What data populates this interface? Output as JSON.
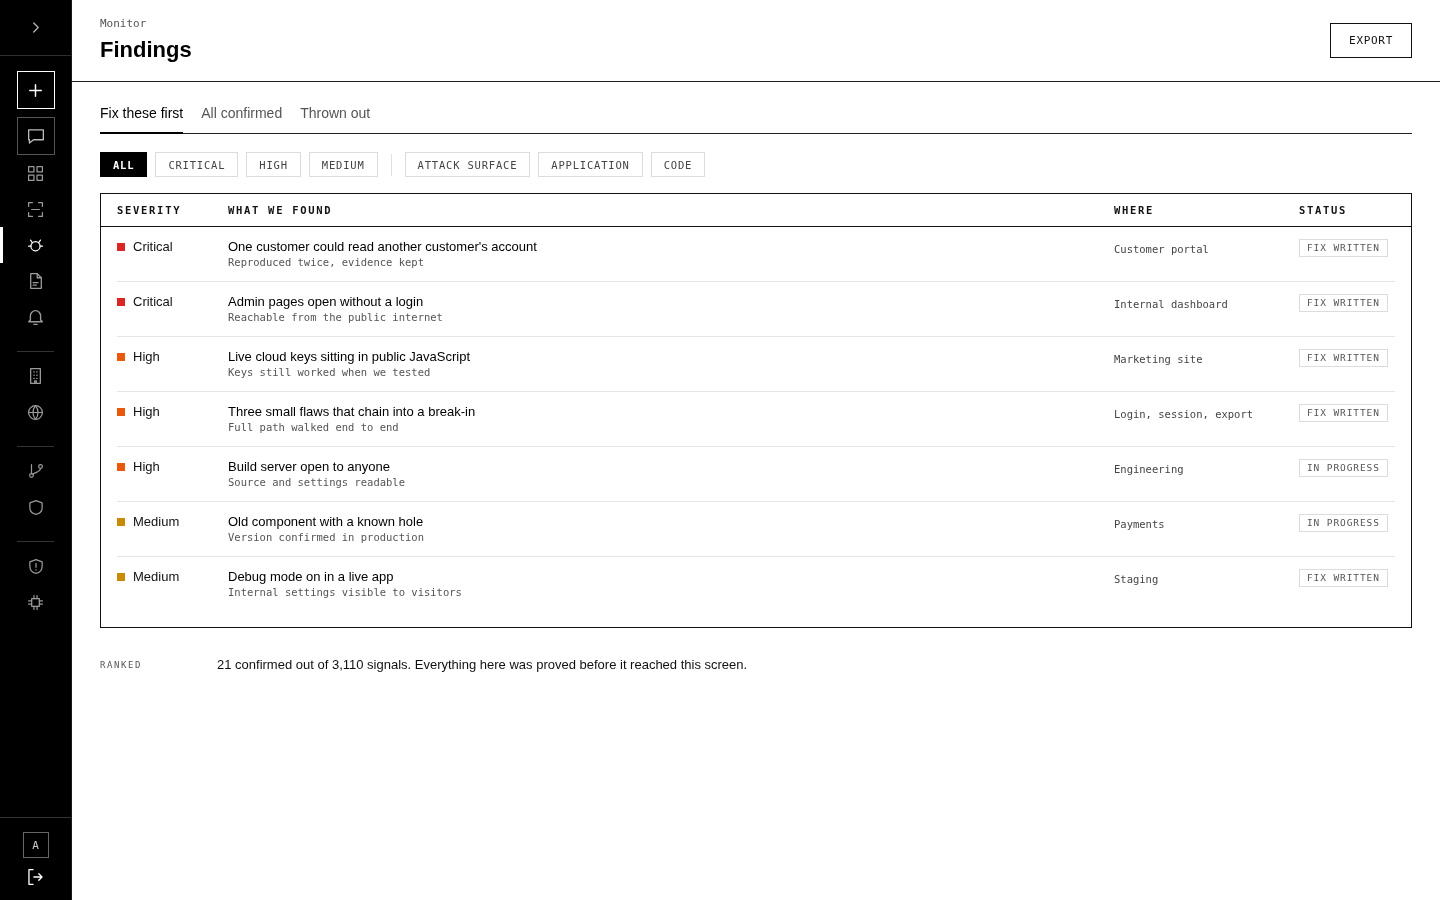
{
  "sidebar": {
    "actions": [
      {
        "kind": "primary"
      },
      {
        "kind": "secondary"
      }
    ],
    "groups": [
      {
        "items": [
          {
            "selected": false
          },
          {
            "selected": false
          },
          {
            "selected": true
          },
          {
            "selected": false
          },
          {
            "selected": false
          }
        ]
      },
      {
        "items": [
          {
            "selected": false
          },
          {
            "selected": false
          }
        ]
      },
      {
        "items": [
          {
            "selected": false
          },
          {
            "selected": false
          }
        ]
      },
      {
        "items": [
          {
            "selected": false
          },
          {
            "selected": false
          }
        ]
      }
    ],
    "avatar": "A"
  },
  "header": {
    "breadcrumb": "Monitor",
    "title": "Findings",
    "action": "EXPORT"
  },
  "tabs": [
    {
      "label": "Fix these first",
      "selected": true
    },
    {
      "label": "All confirmed",
      "selected": false
    },
    {
      "label": "Thrown out",
      "selected": false
    }
  ],
  "filters": [
    {
      "items": [
        {
          "label": "ALL",
          "selected": true
        },
        {
          "label": "CRITICAL",
          "selected": false
        },
        {
          "label": "HIGH",
          "selected": false
        },
        {
          "label": "MEDIUM",
          "selected": false
        }
      ]
    },
    {
      "items": [
        {
          "label": "ATTACK SURFACE",
          "selected": false
        },
        {
          "label": "APPLICATION",
          "selected": false
        },
        {
          "label": "CODE",
          "selected": false
        }
      ]
    }
  ],
  "table": {
    "columns": [
      "SEVERITY",
      "WHAT WE FOUND",
      "WHERE",
      "STATUS"
    ],
    "rows": [
      {
        "severity": "Critical",
        "color": "#dc2626",
        "title": "One customer could read another customer's account",
        "detail": "Reproduced twice, evidence kept",
        "where": "Customer portal",
        "status": "FIX WRITTEN"
      },
      {
        "severity": "Critical",
        "color": "#dc2626",
        "title": "Admin pages open without a login",
        "detail": "Reachable from the public internet",
        "where": "Internal dashboard",
        "status": "FIX WRITTEN"
      },
      {
        "severity": "High",
        "color": "#ea580c",
        "title": "Live cloud keys sitting in public JavaScript",
        "detail": "Keys still worked when we tested",
        "where": "Marketing site",
        "status": "FIX WRITTEN"
      },
      {
        "severity": "High",
        "color": "#ea580c",
        "title": "Three small flaws that chain into a break-in",
        "detail": "Full path walked end to end",
        "where": "Login, session, export",
        "status": "FIX WRITTEN"
      },
      {
        "severity": "High",
        "color": "#ea580c",
        "title": "Build server open to anyone",
        "detail": "Source and settings readable",
        "where": "Engineering",
        "status": "IN PROGRESS"
      },
      {
        "severity": "Medium",
        "color": "#ca8a04",
        "title": "Old component with a known hole",
        "detail": "Version confirmed in production",
        "where": "Payments",
        "status": "IN PROGRESS"
      },
      {
        "severity": "Medium",
        "color": "#ca8a04",
        "title": "Debug mode on in a live app",
        "detail": "Internal settings visible to visitors",
        "where": "Staging",
        "status": "FIX WRITTEN"
      }
    ]
  },
  "footer": {
    "label": "RANKED",
    "text": "21 confirmed out of 3,110 signals. Everything here was proved before it reached this screen."
  }
}
